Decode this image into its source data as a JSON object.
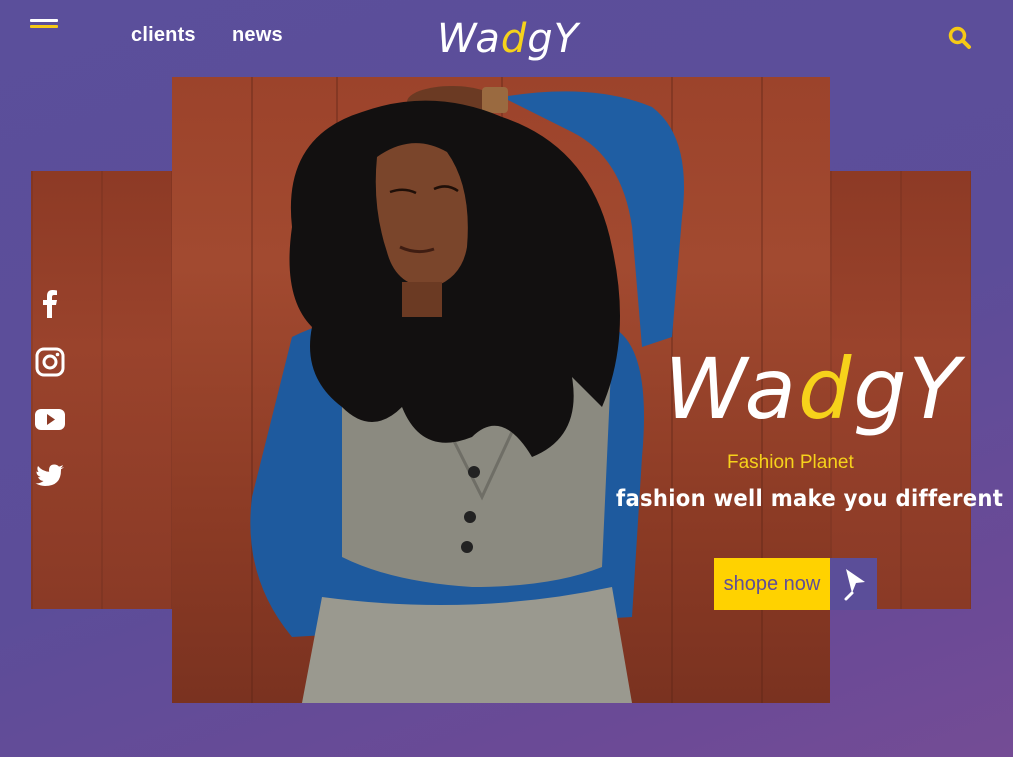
{
  "header": {
    "nav": [
      {
        "label": "clients"
      },
      {
        "label": "news"
      }
    ],
    "logo": {
      "part1": "Wa",
      "highlight": "d",
      "part2": "gY"
    },
    "icons": {
      "menu": "hamburger-menu-icon",
      "search": "search-icon"
    }
  },
  "hero": {
    "logo": {
      "part1": "Wa",
      "highlight": "d",
      "part2": "gY"
    },
    "tagline": "Fashion Planet",
    "slogan": "fashion well make you different",
    "cta_label": "shope now",
    "cta_icon": "cursor-arrow-icon"
  },
  "social": [
    {
      "icon": "facebook-icon"
    },
    {
      "icon": "instagram-icon"
    },
    {
      "icon": "youtube-icon"
    },
    {
      "icon": "twitter-icon"
    }
  ],
  "colors": {
    "accent": "#f6d21b",
    "button": "#ffd200",
    "background": "#5c4d99",
    "button_text": "#5f4e98"
  }
}
